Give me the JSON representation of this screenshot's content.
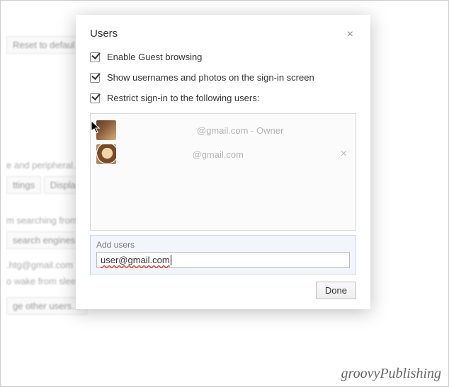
{
  "bg": {
    "reset_btn": "Reset to defaul…",
    "periph": "e and peripheral…",
    "ttings_btn": "ttings",
    "displa_btn": "Displa…",
    "search_from": "m searching from…",
    "search_engines_btn": "search engines…",
    "htg_email": ".htg@gmail.com",
    "wake": "o wake from slee…",
    "manage_users_btn": "ge other users…"
  },
  "dialog": {
    "title": "Users",
    "close_glyph": "×",
    "opt_guest": "Enable Guest browsing",
    "opt_show": "Show usernames and photos on the sign-in screen",
    "opt_restrict": "Restrict sign-in to the following users:",
    "users": [
      {
        "email": "@gmail.com",
        "suffix": " - Owner",
        "removable": false
      },
      {
        "email": "@gmail.com",
        "suffix": "",
        "removable": true
      }
    ],
    "add_label": "Add users",
    "add_value": "user@gmail.com",
    "done": "Done"
  },
  "watermark": "groovyPublishing"
}
